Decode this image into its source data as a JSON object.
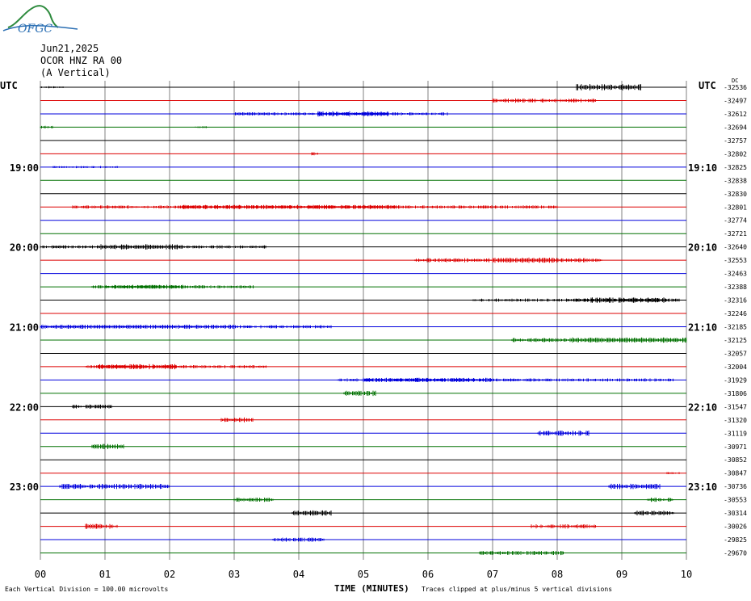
{
  "logo": {
    "text": "OFGC",
    "color": "#2b6fb3",
    "hill_color": "#2e8b3e"
  },
  "header": {
    "date": "Jun21,2025",
    "station": "OCOR HNZ RA 00",
    "component": "(A Vertical)"
  },
  "left_axis_title": "UTC",
  "right_axis_title": "UTC",
  "right_top_label": "DC",
  "footer": {
    "scale_note": "Each Vertical Division =  100.00 microvolts",
    "xlabel": "TIME (MINUTES)",
    "clip_note": "Traces clipped at plus/minus 5 vertical divisions"
  },
  "colors": {
    "black": "#000000",
    "red": "#dd0000",
    "blue": "#0000dd",
    "green": "#007000",
    "grid": "#808080"
  },
  "chart_data": {
    "type": "line",
    "title": "",
    "xlabel": "TIME (MINUTES)",
    "ylabel": "UTC",
    "x_ticks": [
      "00",
      "01",
      "02",
      "03",
      "04",
      "05",
      "06",
      "07",
      "08",
      "09",
      "10"
    ],
    "xlim": [
      0,
      10
    ],
    "left_time_labels": [
      {
        "row": 6,
        "text": "19:00"
      },
      {
        "row": 12,
        "text": "20:00"
      },
      {
        "row": 18,
        "text": "21:00"
      },
      {
        "row": 24,
        "text": "22:00"
      },
      {
        "row": 30,
        "text": "23:00"
      }
    ],
    "right_time_labels": [
      {
        "row": 6,
        "text": "19:10"
      },
      {
        "row": 12,
        "text": "20:10"
      },
      {
        "row": 18,
        "text": "21:10"
      },
      {
        "row": 24,
        "text": "22:10"
      },
      {
        "row": 30,
        "text": "23:10"
      }
    ],
    "trace_color_cycle": [
      "black",
      "red",
      "blue",
      "green"
    ],
    "dc_offsets": [
      "-32536",
      "-32497",
      "-32612",
      "-32694",
      "-32757",
      "-32802",
      "-32825",
      "-32838",
      "-32830",
      "-32801",
      "-32774",
      "-32721",
      "-32640",
      "-32553",
      "-32463",
      "-32388",
      "-32316",
      "-32246",
      "-32185",
      "-32125",
      "-32057",
      "-32004",
      "-31929",
      "-31806",
      "-31547",
      "-31320",
      "-31119",
      "-30971",
      "-30852",
      "-30847",
      "-30736",
      "-30553",
      "-30314",
      "-30026",
      "-29825",
      "-29670"
    ],
    "activity": [
      [
        [
          0,
          0.4,
          1
        ],
        [
          8.3,
          9.3,
          3
        ]
      ],
      [
        [
          7.0,
          8.6,
          2
        ]
      ],
      [
        [
          3.0,
          6.3,
          1.5
        ],
        [
          4.3,
          5.4,
          2.5
        ]
      ],
      [
        [
          0,
          0.2,
          1.5
        ],
        [
          2.4,
          2.6,
          1
        ]
      ],
      [],
      [
        [
          4.2,
          4.3,
          1.5
        ]
      ],
      [
        [
          0.2,
          1.2,
          1
        ]
      ],
      [],
      [],
      [
        [
          0.5,
          8.0,
          1.5
        ],
        [
          2.2,
          5.5,
          2
        ]
      ],
      [],
      [],
      [
        [
          0,
          3.5,
          1.5
        ],
        [
          0.9,
          2.2,
          2.5
        ]
      ],
      [
        [
          5.8,
          8.7,
          2
        ],
        [
          7.0,
          8.0,
          2.5
        ]
      ],
      [],
      [
        [
          0.8,
          3.3,
          1.5
        ],
        [
          1.0,
          2.2,
          2
        ]
      ],
      [
        [
          6.7,
          9.9,
          1.5
        ],
        [
          8.3,
          9.7,
          2.5
        ]
      ],
      [],
      [
        [
          0,
          4.5,
          1.5
        ],
        [
          0,
          3.0,
          2
        ]
      ],
      [
        [
          7.3,
          10,
          2
        ],
        [
          8.2,
          10,
          2.5
        ]
      ],
      [],
      [
        [
          0.7,
          3.5,
          1.5
        ],
        [
          0.9,
          2.1,
          2.5
        ]
      ],
      [
        [
          4.6,
          9.8,
          1.5
        ],
        [
          5.0,
          7.0,
          2
        ]
      ],
      [
        [
          4.7,
          5.2,
          2.5
        ]
      ],
      [
        [
          0.5,
          1.1,
          2
        ]
      ],
      [
        [
          2.8,
          3.3,
          2.5
        ]
      ],
      [
        [
          7.7,
          8.5,
          2.5
        ]
      ],
      [
        [
          0.8,
          1.3,
          2.5
        ]
      ],
      [],
      [
        [
          9.7,
          9.9,
          1
        ]
      ],
      [
        [
          0.3,
          2.0,
          2.5
        ],
        [
          8.8,
          9.6,
          2.5
        ]
      ],
      [
        [
          3.0,
          3.6,
          2
        ],
        [
          9.4,
          9.8,
          2
        ]
      ],
      [
        [
          3.9,
          4.5,
          2.5
        ],
        [
          9.2,
          9.8,
          2.5
        ]
      ],
      [
        [
          0.7,
          1.2,
          2.5
        ],
        [
          7.6,
          8.6,
          2
        ]
      ],
      [
        [
          3.6,
          4.4,
          2
        ]
      ],
      [
        [
          6.8,
          8.1,
          2
        ]
      ]
    ]
  }
}
